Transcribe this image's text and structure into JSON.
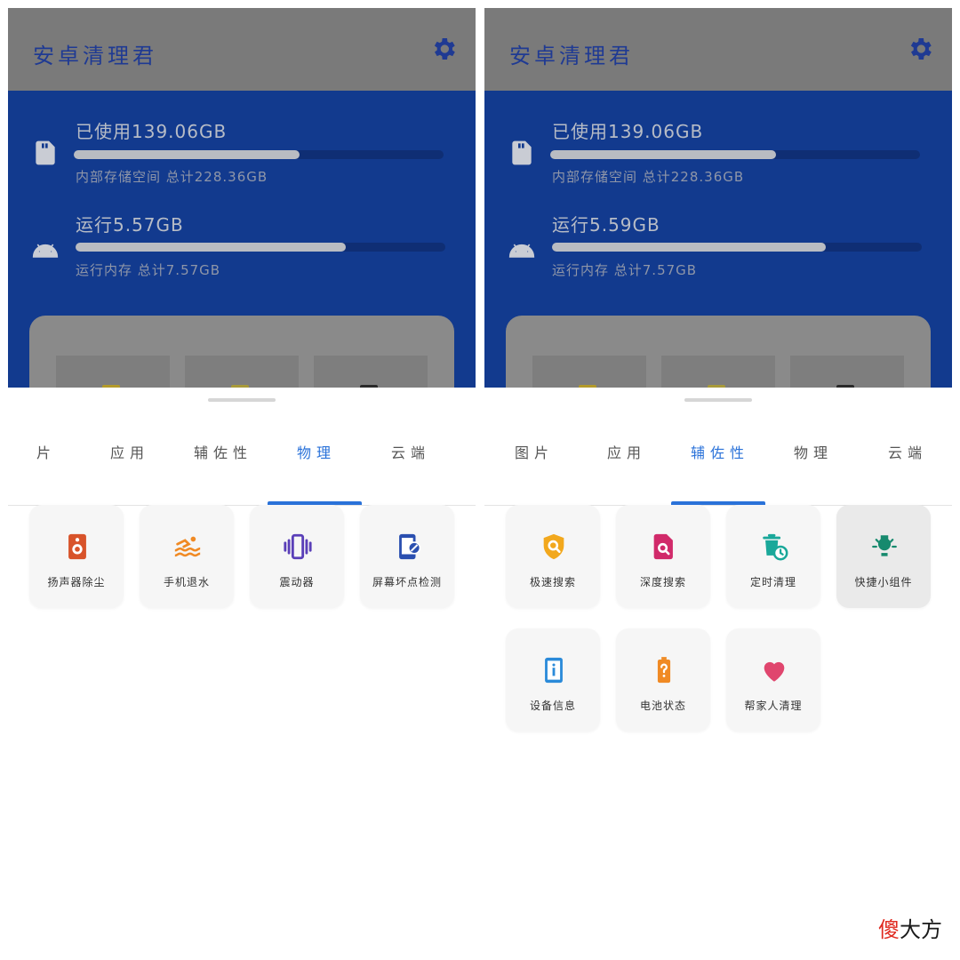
{
  "left": {
    "app_title": "安卓清理君",
    "storage": {
      "used_label": "已使用139.06GB",
      "used_fraction": 0.61,
      "sub_label": "内部存储空间 总计228.36GB"
    },
    "ram": {
      "used_label": "运行5.57GB",
      "used_fraction": 0.73,
      "sub_label": "运行内存 总计7.57GB"
    },
    "tabs": [
      "片",
      "应用",
      "辅佐性",
      "物理",
      "云端"
    ],
    "active_tab": "物理",
    "tiles": [
      {
        "label": "扬声器除尘",
        "icon": "speaker-icon"
      },
      {
        "label": "手机退水",
        "icon": "swim-icon"
      },
      {
        "label": "震动器",
        "icon": "vibration-icon"
      },
      {
        "label": "屏幕坏点检测",
        "icon": "screen-check-icon"
      }
    ]
  },
  "right": {
    "app_title": "安卓清理君",
    "storage": {
      "used_label": "已使用139.06GB",
      "used_fraction": 0.61,
      "sub_label": "内部存储空间 总计228.36GB"
    },
    "ram": {
      "used_label": "运行5.59GB",
      "used_fraction": 0.74,
      "sub_label": "运行内存 总计7.57GB"
    },
    "tabs": [
      "图片",
      "应用",
      "辅佐性",
      "物理",
      "云端"
    ],
    "active_tab": "辅佐性",
    "tiles": [
      {
        "label": "极速搜索",
        "icon": "shield-search-icon"
      },
      {
        "label": "深度搜索",
        "icon": "file-search-icon"
      },
      {
        "label": "定时清理",
        "icon": "timer-trash-icon"
      },
      {
        "label": "快捷小组件",
        "icon": "lightbulb-icon"
      },
      {
        "label": "设备信息",
        "icon": "device-info-icon"
      },
      {
        "label": "电池状态",
        "icon": "battery-unknown-icon"
      },
      {
        "label": "帮家人清理",
        "icon": "heart-icon"
      }
    ]
  },
  "colors": {
    "accent_blue": "#2a72d9",
    "storage_bg": "#123a8e",
    "appbar_bg": "#7a7a7a"
  },
  "watermark": {
    "part1": "傻",
    "part2": "大方"
  }
}
